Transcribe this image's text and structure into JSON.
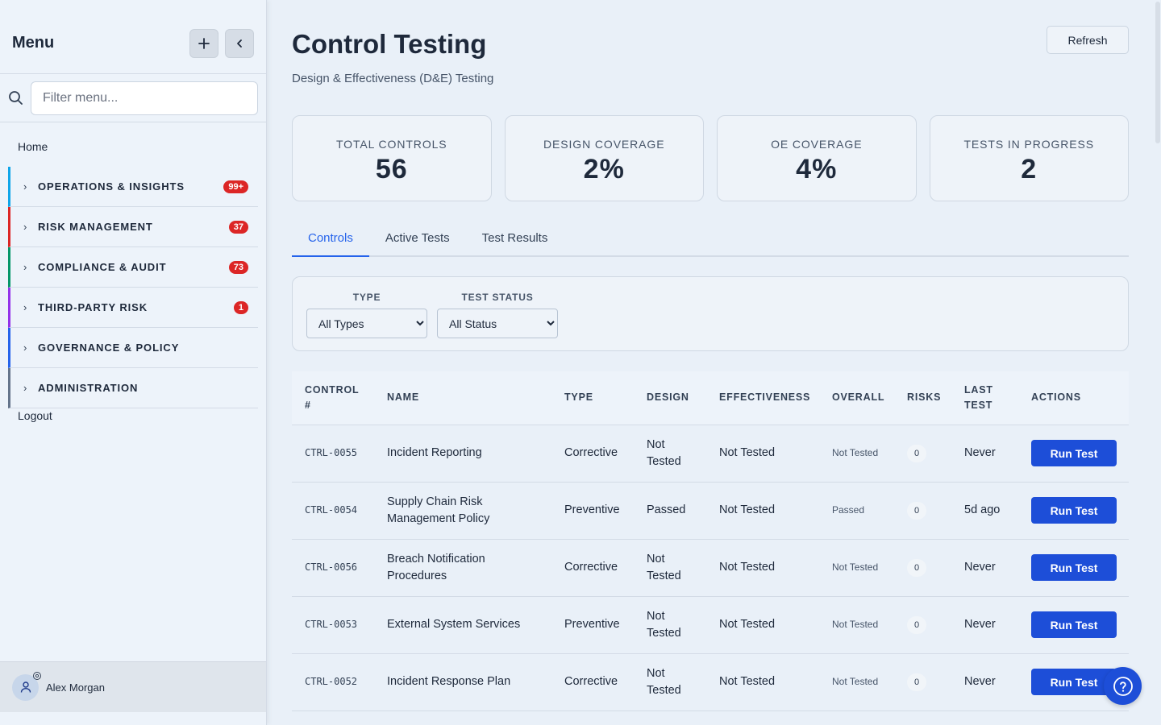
{
  "sidebar": {
    "title": "Menu",
    "search_placeholder": "Filter menu...",
    "home_label": "Home",
    "sections": [
      {
        "label": "OPERATIONS & INSIGHTS",
        "badge": "99+",
        "color": "#0ea5e9"
      },
      {
        "label": "RISK MANAGEMENT",
        "badge": "37",
        "color": "#dc2626"
      },
      {
        "label": "COMPLIANCE & AUDIT",
        "badge": "73",
        "color": "#059669"
      },
      {
        "label": "THIRD-PARTY RISK",
        "badge": "1",
        "color": "#9333ea"
      },
      {
        "label": "GOVERNANCE & POLICY",
        "badge": "",
        "color": "#2563eb"
      },
      {
        "label": "ADMINISTRATION",
        "badge": "",
        "color": "#64748b"
      }
    ],
    "logout_label": "Logout",
    "user_name": "Alex Morgan"
  },
  "header": {
    "title": "Control Testing",
    "subtitle": "Design & Effectiveness (D&E) Testing",
    "refresh_label": "Refresh"
  },
  "stats": [
    {
      "label": "TOTAL CONTROLS",
      "value": "56"
    },
    {
      "label": "DESIGN COVERAGE",
      "value": "2%"
    },
    {
      "label": "OE COVERAGE",
      "value": "4%"
    },
    {
      "label": "TESTS IN PROGRESS",
      "value": "2"
    }
  ],
  "tabs": [
    {
      "label": "Controls",
      "active": true
    },
    {
      "label": "Active Tests",
      "active": false
    },
    {
      "label": "Test Results",
      "active": false
    }
  ],
  "filters": {
    "type_label": "TYPE",
    "type_value": "All Types",
    "status_label": "TEST STATUS",
    "status_value": "All Status"
  },
  "table": {
    "columns": [
      "CONTROL #",
      "NAME",
      "TYPE",
      "DESIGN",
      "EFFECTIVENESS",
      "OVERALL",
      "RISKS",
      "LAST TEST",
      "ACTIONS"
    ],
    "rows": [
      {
        "control": "CTRL-0055",
        "name": "Incident Reporting",
        "type": "Corrective",
        "design": "Not Tested",
        "effectiveness": "Not Tested",
        "overall": "Not Tested",
        "risks": "0",
        "last_test": "Never",
        "action": "Run Test"
      },
      {
        "control": "CTRL-0054",
        "name": "Supply Chain Risk Management Policy",
        "type": "Preventive",
        "design": "Passed",
        "effectiveness": "Not Tested",
        "overall": "Passed",
        "risks": "0",
        "last_test": "5d ago",
        "action": "Run Test"
      },
      {
        "control": "CTRL-0056",
        "name": "Breach Notification Procedures",
        "type": "Corrective",
        "design": "Not Tested",
        "effectiveness": "Not Tested",
        "overall": "Not Tested",
        "risks": "0",
        "last_test": "Never",
        "action": "Run Test"
      },
      {
        "control": "CTRL-0053",
        "name": "External System Services",
        "type": "Preventive",
        "design": "Not Tested",
        "effectiveness": "Not Tested",
        "overall": "Not Tested",
        "risks": "0",
        "last_test": "Never",
        "action": "Run Test"
      },
      {
        "control": "CTRL-0052",
        "name": "Incident Response Plan",
        "type": "Corrective",
        "design": "Not Tested",
        "effectiveness": "Not Tested",
        "overall": "Not Tested",
        "risks": "0",
        "last_test": "Never",
        "action": "Run Test"
      }
    ]
  },
  "icons": {
    "add": "plus-icon",
    "collapse": "chevron-left-icon",
    "search": "search-icon",
    "section": "chevron-right-icon",
    "user": "user-icon",
    "help": "question-circle-icon"
  },
  "colors": {
    "accent": "#1d4ed8",
    "badge": "#dc2626"
  }
}
